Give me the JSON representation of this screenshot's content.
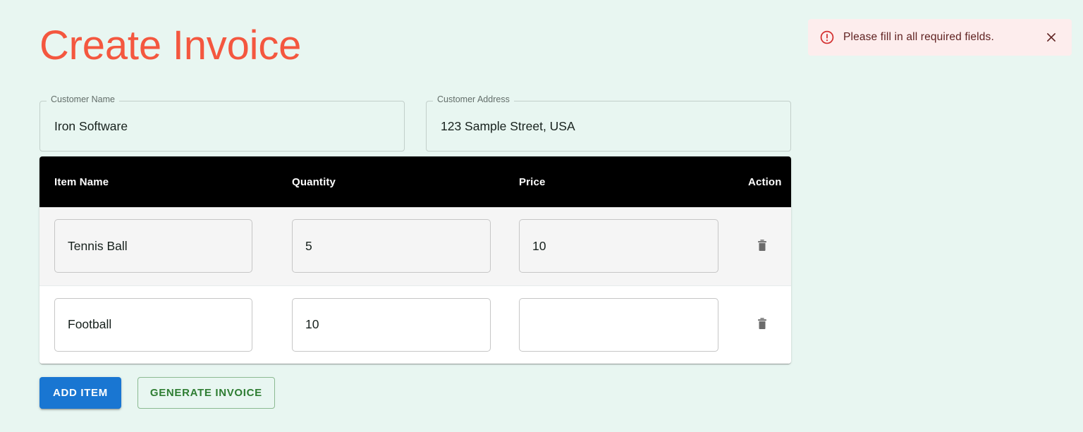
{
  "page": {
    "title": "Create Invoice",
    "background_color": "#e8f6f1",
    "title_color": "#f4573f"
  },
  "alert": {
    "icon": "error-circle-icon",
    "message": "Please fill in all required fields.",
    "close_icon": "close-icon",
    "background_color": "#fdeded",
    "text_color": "#5f2120",
    "icon_color": "#d32f2f"
  },
  "customer": {
    "name_field": {
      "label": "Customer Name",
      "value": "Iron Software",
      "placeholder": ""
    },
    "address_field": {
      "label": "Customer Address",
      "value": "123 Sample Street, USA",
      "placeholder": ""
    }
  },
  "items_table": {
    "headers": [
      "Item Name",
      "Quantity",
      "Price",
      "Action"
    ],
    "header_background": "#000000",
    "header_text_color": "#ffffff",
    "rows": [
      {
        "item_name": "Tennis Ball",
        "quantity": "5",
        "price": "10",
        "delete_icon": "trash-icon"
      },
      {
        "item_name": "Football",
        "quantity": "10",
        "price": "",
        "delete_icon": "trash-icon"
      }
    ]
  },
  "actions": {
    "add_item_label": "ADD ITEM",
    "generate_invoice_label": "GENERATE INVOICE",
    "add_item_color": "#1976d2",
    "generate_invoice_color": "#2e7d32"
  }
}
